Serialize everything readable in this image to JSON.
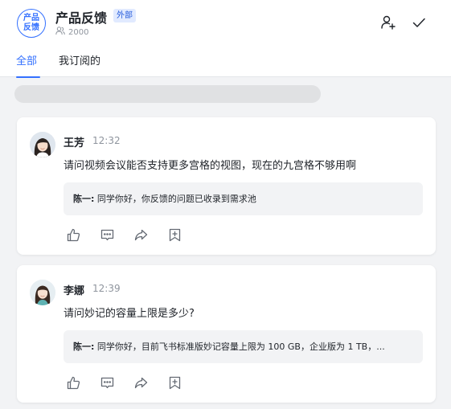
{
  "header": {
    "logo_line1": "产品",
    "logo_line2": "反馈",
    "title": "产品反馈",
    "badge": "外部",
    "member_count": "2000"
  },
  "tabs": [
    {
      "label": "全部",
      "active": true
    },
    {
      "label": "我订阅的",
      "active": false
    }
  ],
  "posts": [
    {
      "author": "王芳",
      "time": "12:32",
      "question": "请问视频会议能否支持更多宫格的视图，现在的九宫格不够用啊",
      "reply_author": "陈一:",
      "reply_text": "同学你好，你反馈的问题已收录到需求池"
    },
    {
      "author": "李娜",
      "time": "12:39",
      "question": "请问妙记的容量上限是多少?",
      "reply_author": "陈一:",
      "reply_text": "同学你好，目前飞书标准版妙记容量上限为 100 GB，企业版为 1 TB，..."
    }
  ],
  "colors": {
    "accent": "#3370ff",
    "muted": "#8f959e",
    "background": "#f2f3f5"
  }
}
